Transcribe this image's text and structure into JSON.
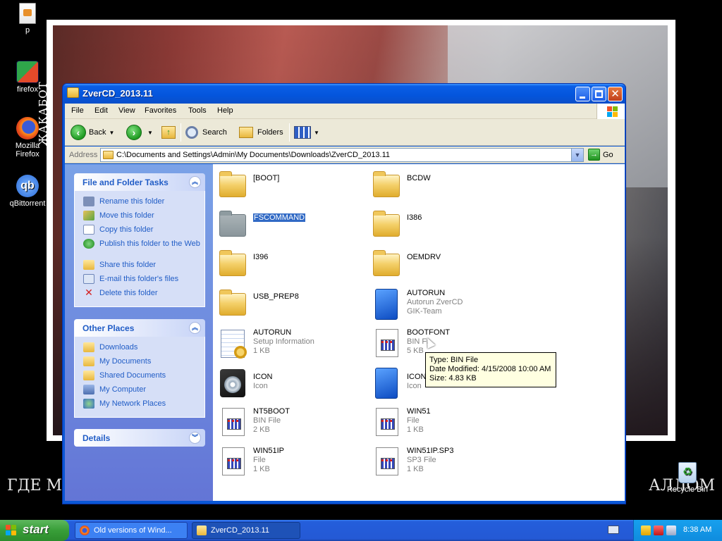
{
  "desktop": {
    "icons": [
      {
        "label": "p"
      },
      {
        "label": "firefox"
      },
      {
        "label": "Mozilla Firefox"
      },
      {
        "label": "qBittorrent"
      },
      {
        "label": "Recycle Bin"
      }
    ],
    "vertical_caption": "ЖАКАБОТ",
    "bottom_caption_left": "ГДЕ М",
    "bottom_caption_right": "АЛЛОМ"
  },
  "window": {
    "title": "ZverCD_2013.11",
    "menu": [
      "File",
      "Edit",
      "View",
      "Favorites",
      "Tools",
      "Help"
    ],
    "toolbar": {
      "back": "Back",
      "search": "Search",
      "folders": "Folders"
    },
    "address": {
      "label": "Address",
      "path": "C:\\Documents and Settings\\Admin\\My Documents\\Downloads\\ZverCD_2013.11",
      "go": "Go"
    }
  },
  "taskpane": {
    "file_tasks": {
      "title": "File and Folder Tasks",
      "items": [
        {
          "label": "Rename this folder"
        },
        {
          "label": "Move this folder"
        },
        {
          "label": "Copy this folder"
        },
        {
          "label": "Publish this folder to the Web"
        },
        {
          "label": "Share this folder"
        },
        {
          "label": "E-mail this folder's files"
        },
        {
          "label": "Delete this folder"
        }
      ]
    },
    "other_places": {
      "title": "Other Places",
      "items": [
        {
          "label": "Downloads"
        },
        {
          "label": "My Documents"
        },
        {
          "label": "Shared Documents"
        },
        {
          "label": "My Computer"
        },
        {
          "label": "My Network Places"
        }
      ]
    },
    "details": {
      "title": "Details"
    }
  },
  "files": [
    {
      "name": "[BOOT]",
      "type": "folder"
    },
    {
      "name": "BCDW",
      "type": "folder"
    },
    {
      "name": "FSCOMMAND",
      "type": "folder",
      "selected": true
    },
    {
      "name": "I386",
      "type": "folder"
    },
    {
      "name": "I396",
      "type": "folder"
    },
    {
      "name": "OEMDRV",
      "type": "folder"
    },
    {
      "name": "USB_PREP8",
      "type": "folder"
    },
    {
      "name": "AUTORUN",
      "type": "autorun",
      "line1": "Autorun ZverCD",
      "line2": "GIK-Team"
    },
    {
      "name": "AUTORUN",
      "type": "setup",
      "line1": "Setup Information",
      "line2": "1 KB"
    },
    {
      "name": "BOOTFONT",
      "type": "bin",
      "line1": "BIN Fi",
      "line2": "5 KB"
    },
    {
      "name": "ICON",
      "type": "cd",
      "line1": "Icon"
    },
    {
      "name": "ICON",
      "type": "autorun",
      "line1": "Icon"
    },
    {
      "name": "NT5BOOT",
      "type": "bin",
      "line1": "BIN File",
      "line2": "2 KB"
    },
    {
      "name": "WIN51",
      "type": "bin",
      "line1": "File",
      "line2": "1 KB"
    },
    {
      "name": "WIN51IP",
      "type": "bin",
      "line1": "File",
      "line2": "1 KB"
    },
    {
      "name": "WIN51IP.SP3",
      "type": "bin",
      "line1": "SP3 File",
      "line2": "1 KB"
    }
  ],
  "tooltip": {
    "type": "Type: BIN File",
    "modified": "Date Modified: 4/15/2008 10:00 AM",
    "size": "Size: 4.83 KB"
  },
  "taskbar": {
    "start": "start",
    "buttons": [
      {
        "label": "Old versions of Wind..."
      },
      {
        "label": "ZverCD_2013.11"
      }
    ],
    "clock": "8:38 AM"
  }
}
